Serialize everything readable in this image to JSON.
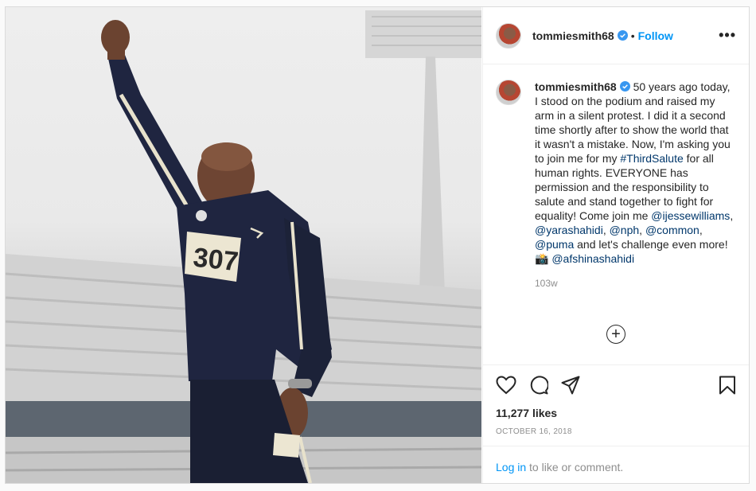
{
  "post": {
    "username": "tommiesmith68",
    "follow_label": "Follow",
    "separator": "•",
    "more_label": "•••",
    "caption": {
      "intro": "50 years ago today, I stood on the podium and raised my arm in a silent protest. I did it a second time shortly after to show the world that it wasn't a mistake. Now, I'm asking you to join me for my ",
      "hashtag": "#ThirdSalute",
      "middle": " for all human rights. EVERYONE has permission and the responsibility to salute and stand together to fight for equality! Come join me ",
      "mention1": "@ijessewilliams",
      "sep1": ",",
      "mention2": "@yarashahidi",
      "sep2": ", ",
      "mention3": "@nph",
      "sep3": ", ",
      "mention4": "@common",
      "sep4": ",",
      "mention5": "@puma",
      "tail": " and let's challenge even more! 📸 ",
      "mention6": "@afshinashahidi"
    },
    "age": "103w",
    "likes": "11,277 likes",
    "date": "OCTOBER 16, 2018",
    "login_link": "Log in",
    "login_rest": " to like or comment.",
    "bib_number": "307"
  },
  "colors": {
    "link_blue": "#0095f6",
    "tag_blue": "#00376b",
    "verified_blue": "#3897f0",
    "jacket_navy": "#1f2540"
  },
  "icons": [
    "verified-icon",
    "heart-icon",
    "comment-icon",
    "share-icon",
    "bookmark-icon",
    "plus-circle-icon"
  ]
}
